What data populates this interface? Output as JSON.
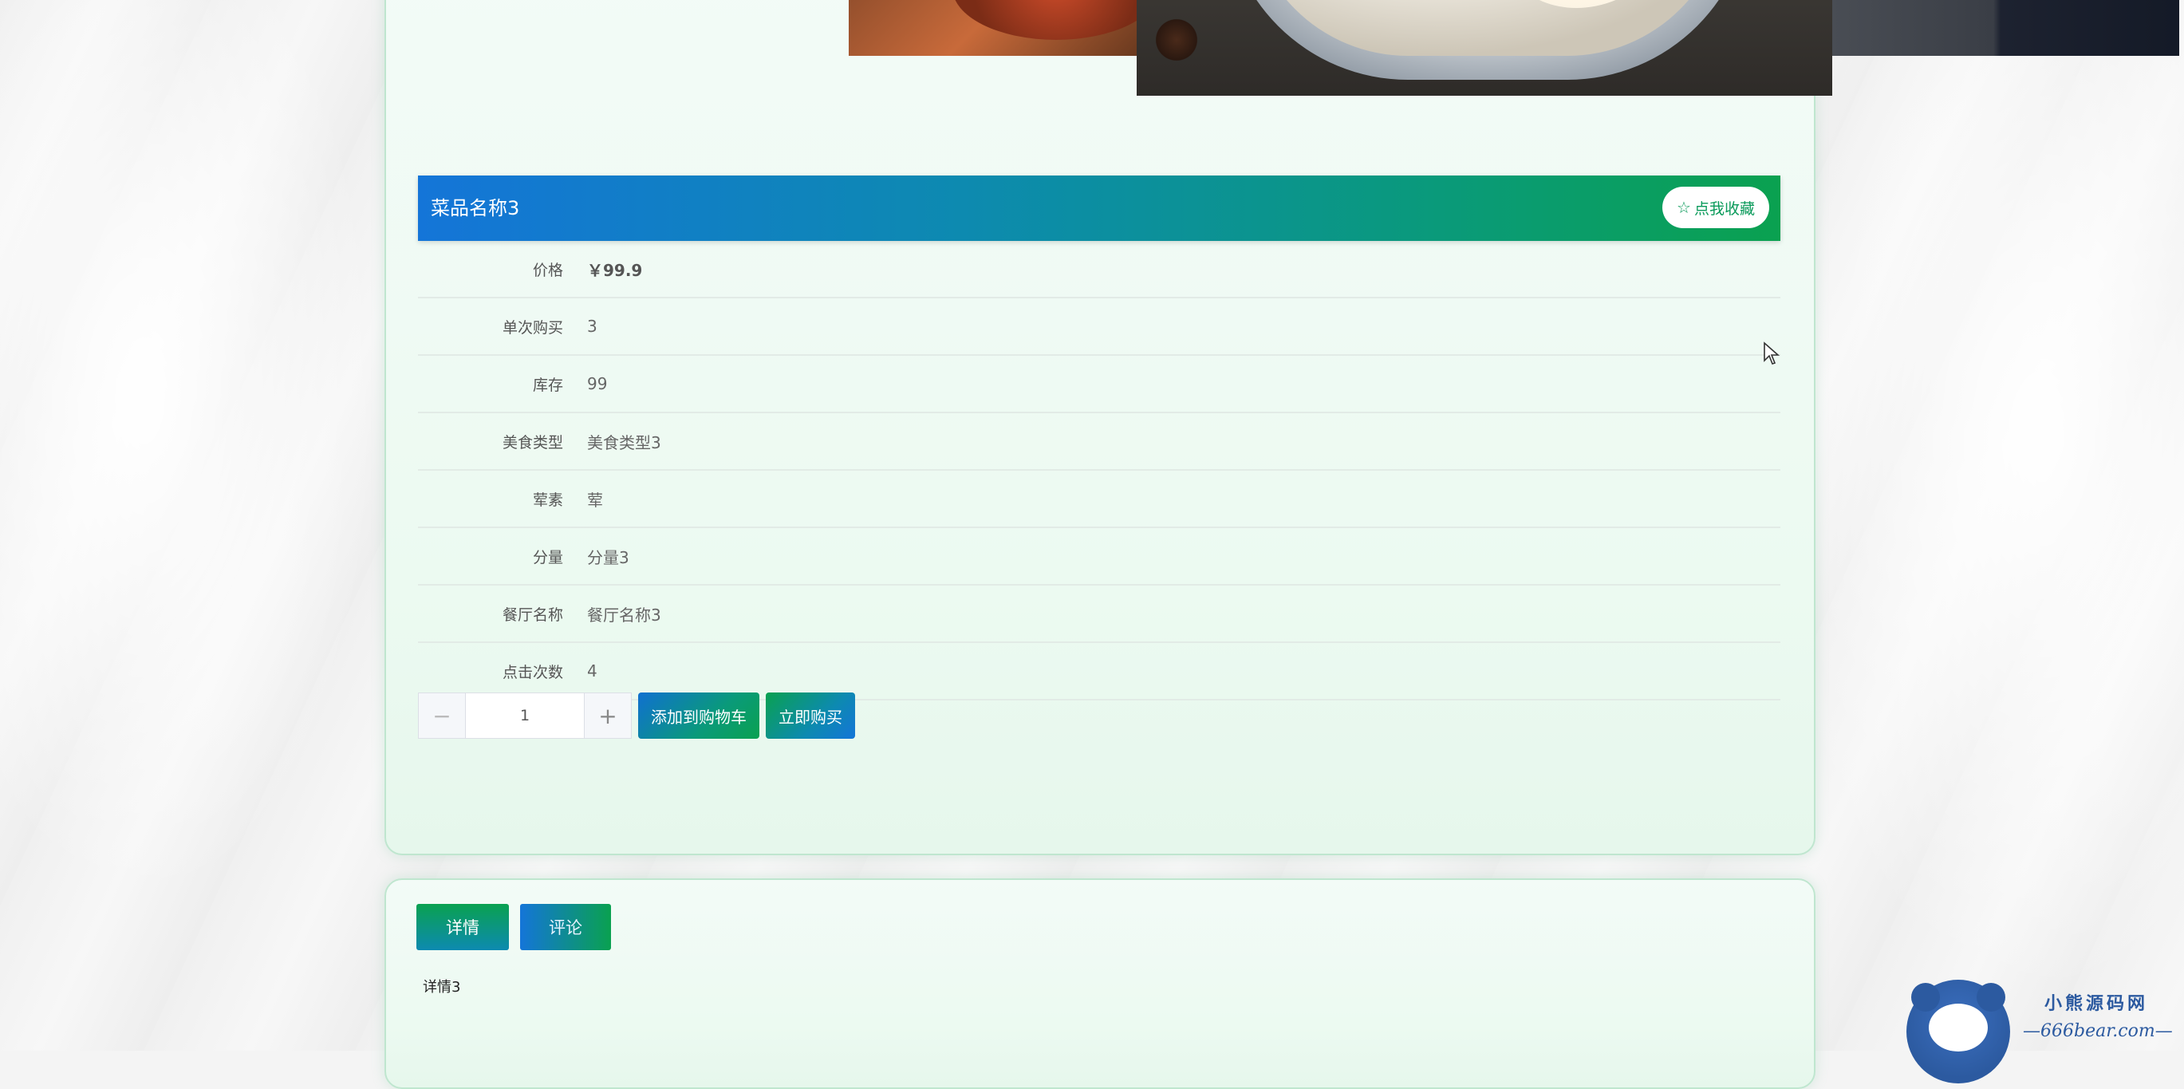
{
  "product": {
    "title": "菜品名称3",
    "favorite_label": "点我收藏",
    "favorite_icon": "star-outline-icon"
  },
  "attributes": [
    {
      "label": "价格",
      "value": "￥99.9"
    },
    {
      "label": "单次购买",
      "value": "3"
    },
    {
      "label": "库存",
      "value": "99"
    },
    {
      "label": "美食类型",
      "value": "美食类型3"
    },
    {
      "label": "荤素",
      "value": "荤"
    },
    {
      "label": "分量",
      "value": "分量3"
    },
    {
      "label": "餐厅名称",
      "value": "餐厅名称3"
    },
    {
      "label": "点击次数",
      "value": "4"
    }
  ],
  "purchase": {
    "quantity": "1",
    "minus_symbol": "−",
    "plus_symbol": "+",
    "add_to_cart_label": "添加到购物车",
    "buy_now_label": "立即购买"
  },
  "tabs": [
    {
      "label": "详情",
      "active": true
    },
    {
      "label": "评论",
      "active": false
    }
  ],
  "detail_content": "详情3",
  "watermark": {
    "title": "小熊源码网",
    "url": "—666bear.com—"
  },
  "colors": {
    "accent_blue": "#1475d8",
    "accent_green": "#0aa150",
    "panel_border": "#bfe6cf"
  }
}
